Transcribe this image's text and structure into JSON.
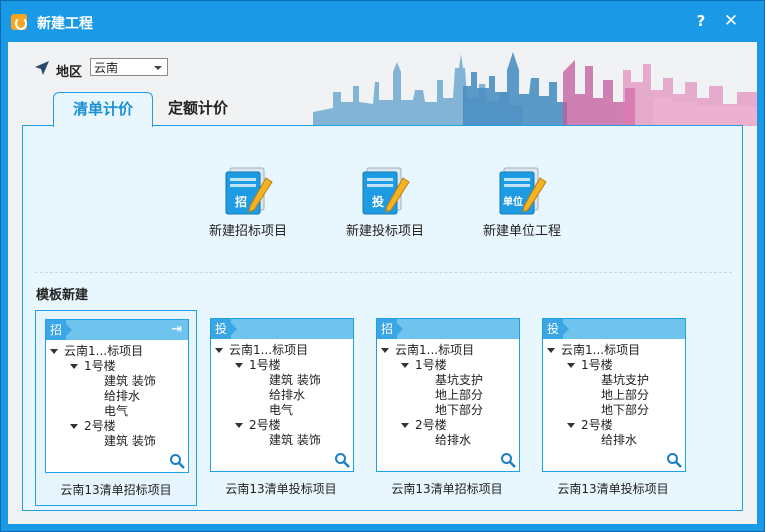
{
  "window": {
    "title": "新建工程",
    "help_label": "?",
    "close_label": "✕"
  },
  "region": {
    "label": "地区",
    "selected": "云南"
  },
  "tabs": [
    {
      "label": "清单计价",
      "active": true
    },
    {
      "label": "定额计价",
      "active": false
    }
  ],
  "actions": [
    {
      "badge": "招",
      "label": "新建招标项目"
    },
    {
      "badge": "投",
      "label": "新建投标项目"
    },
    {
      "badge": "单位",
      "label": "新建单位工程"
    }
  ],
  "templates_title": "模板新建",
  "templates": [
    {
      "badge": "招",
      "root": "云南1...标项目",
      "b1": "1号楼",
      "b1_items": [
        "建筑 装饰",
        "给排水",
        "电气"
      ],
      "b2": "2号楼",
      "b2_items": [
        "建筑 装饰"
      ],
      "label": "云南13清单招标项目"
    },
    {
      "badge": "投",
      "root": "云南1...标项目",
      "b1": "1号楼",
      "b1_items": [
        "建筑 装饰",
        "给排水",
        "电气"
      ],
      "b2": "2号楼",
      "b2_items": [
        "建筑 装饰"
      ],
      "label": "云南13清单投标项目"
    },
    {
      "badge": "招",
      "root": "云南1...标项目",
      "b1": "1号楼",
      "b1_items": [
        "基坑支护",
        "地上部分",
        "地下部分"
      ],
      "b2": "2号楼",
      "b2_items": [
        "给排水"
      ],
      "label": "云南13清单招标项目"
    },
    {
      "badge": "投",
      "root": "云南1...标项目",
      "b1": "1号楼",
      "b1_items": [
        "基坑支护",
        "地上部分",
        "地下部分"
      ],
      "b2": "2号楼",
      "b2_items": [
        "给排水"
      ],
      "label": "云南13清单投标项目"
    }
  ],
  "colors": {
    "accent": "#1a9ae6",
    "tab_active_text": "#1a8fd4",
    "panel_bg": "#e8f6fd",
    "card_header": "#6fc4ee"
  }
}
